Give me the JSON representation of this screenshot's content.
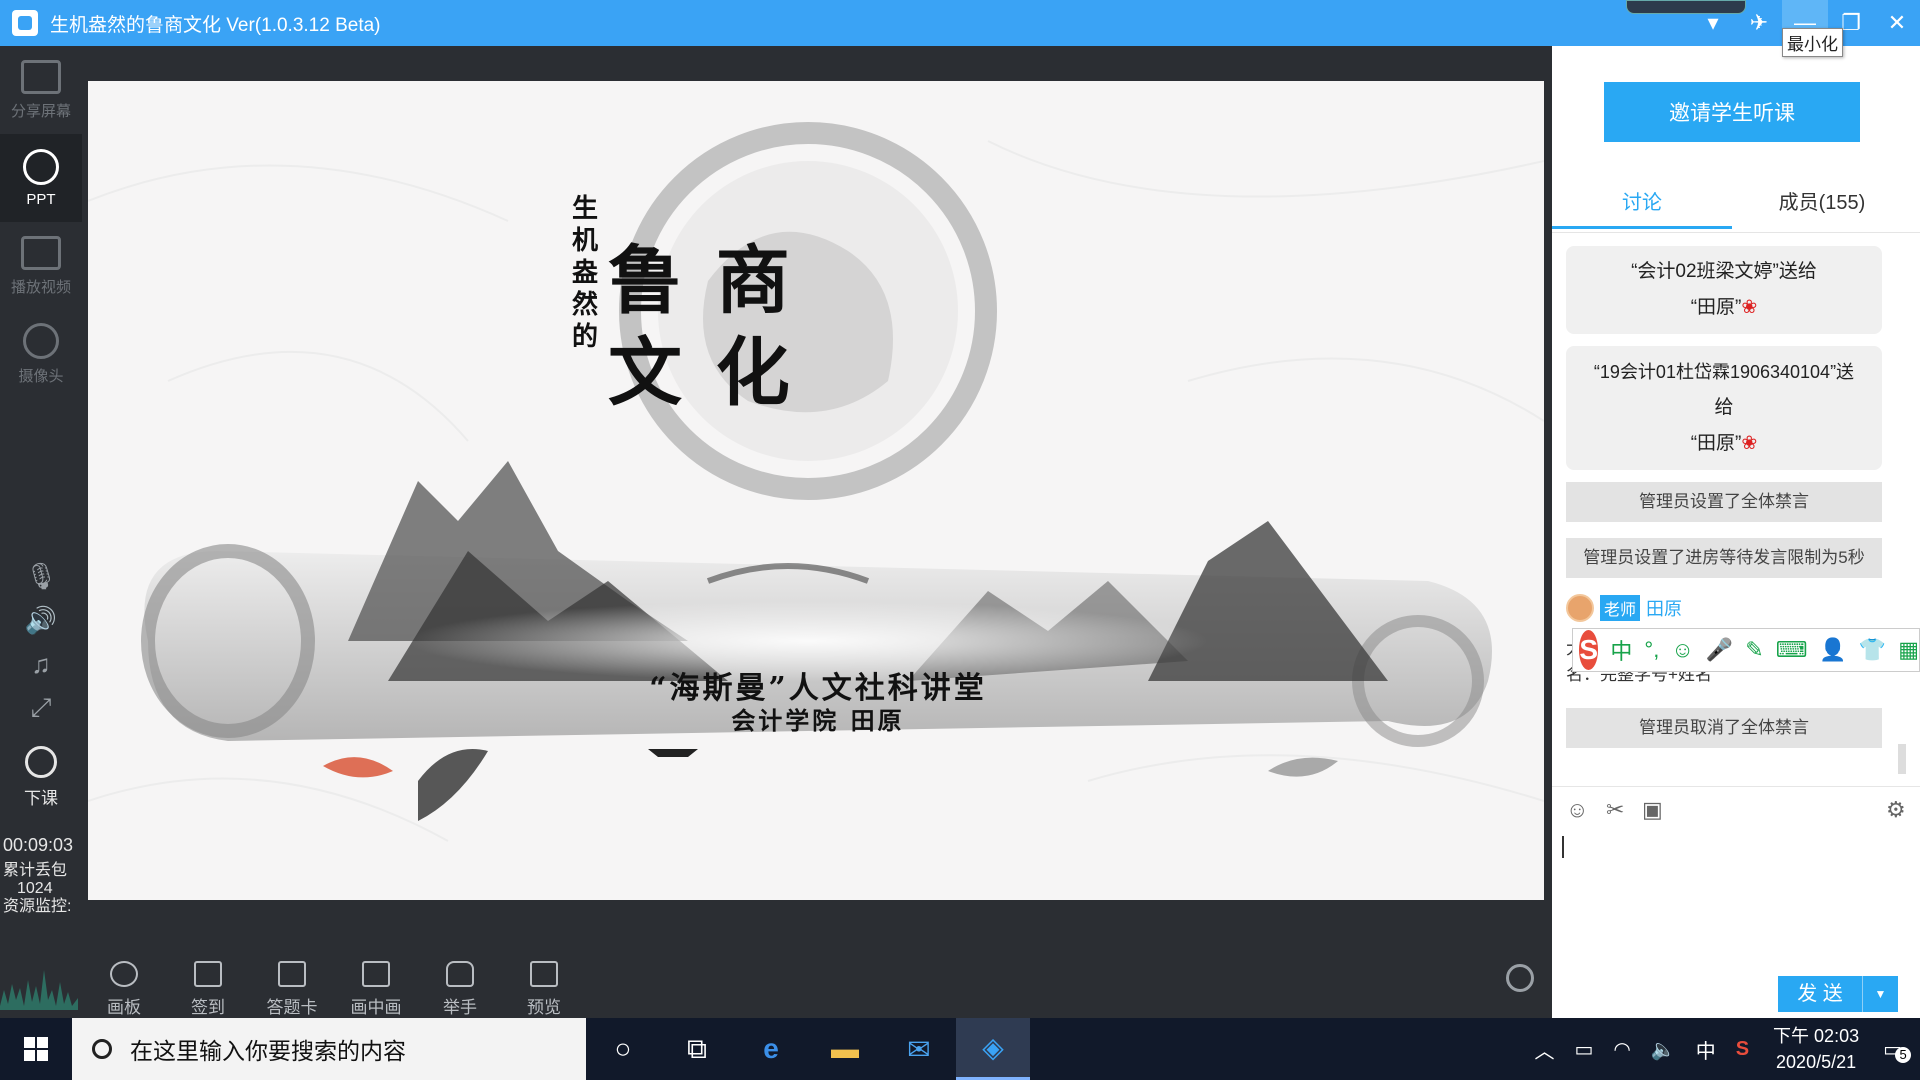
{
  "window": {
    "title": "生机盎然的鲁商文化 Ver(1.0.3.12 Beta)",
    "tooltip_minimize": "最小化",
    "controls": [
      "chevron-down-icon",
      "pin-icon",
      "minimize-icon",
      "restore-icon",
      "close-icon"
    ],
    "accent": "#3aa3f5"
  },
  "left_toolbar": {
    "items": [
      {
        "label": "分享屏幕",
        "icon": "share-screen-icon",
        "active": false
      },
      {
        "label": "PPT",
        "icon": "ppt-icon",
        "active": true
      },
      {
        "label": "播放视频",
        "icon": "play-video-icon",
        "active": false
      },
      {
        "label": "摄像头",
        "icon": "camera-icon",
        "active": false
      }
    ],
    "small_icons": [
      "microphone-icon",
      "speaker-icon",
      "music-icon",
      "fullscreen-icon"
    ],
    "end_class": "下课",
    "timer": "00:09:03",
    "packet_loss_label": "累计丢包",
    "packet_loss_value": "1024",
    "resource_monitor_label": "资源监控:"
  },
  "slide": {
    "vertical_title": [
      "生",
      "机",
      "盎",
      "然",
      "的"
    ],
    "main_title_line1": "鲁 商",
    "main_title_line2": "文 化",
    "subtitle": "“海斯曼”人文社科讲堂",
    "author": "会计学院 田原"
  },
  "bottom_toolbar": {
    "items": [
      {
        "label": "画板",
        "icon": "palette-icon"
      },
      {
        "label": "签到",
        "icon": "check-in-icon"
      },
      {
        "label": "答题卡",
        "icon": "answer-card-icon"
      },
      {
        "label": "画中画",
        "icon": "picture-in-picture-icon"
      },
      {
        "label": "举手",
        "icon": "raise-hand-icon"
      },
      {
        "label": "预览",
        "icon": "preview-icon"
      }
    ]
  },
  "right_panel": {
    "invite_button": "邀请学生听课",
    "tabs": [
      "讨论",
      "成员(155)"
    ],
    "messages": [
      {
        "type": "gift",
        "line1": "“会计02班梁文婷”送给",
        "line2": "“田原”"
      },
      {
        "type": "gift",
        "line1": "“19会计01杜岱霖1906340104”送",
        "line1b": "给",
        "line2": "“田原”"
      },
      {
        "type": "system",
        "text": "管理员设置了全体禁言"
      },
      {
        "type": "system",
        "text": "管理员设置了进房等待发言限制为5秒"
      }
    ],
    "teacher_badge": "老师",
    "teacher_name": "田原",
    "teacher_msg_line1": "大",
    "teacher_msg_line2": "名：完整学号+姓名",
    "system_last": "管理员取消了全体禁言",
    "input_icons": [
      "emoji-icon",
      "scissors-icon",
      "image-icon",
      "settings-icon"
    ],
    "send_button": "发 送"
  },
  "ime_bar": {
    "logo": "S",
    "mode": "中",
    "icons": [
      "punctuation-icon",
      "smile-icon",
      "voice-icon",
      "pen-icon",
      "keyboard-icon",
      "user-icon",
      "shirt-icon",
      "apps-icon"
    ]
  },
  "taskbar": {
    "search_placeholder": "在这里输入你要搜索的内容",
    "apps": [
      "cortana-icon",
      "task-view-icon",
      "edge-icon",
      "file-explorer-icon",
      "mail-icon",
      "classroom-app-icon"
    ],
    "tray_lang": "中",
    "time": "下午 02:03",
    "date": "2020/5/21",
    "notifications": "5"
  }
}
